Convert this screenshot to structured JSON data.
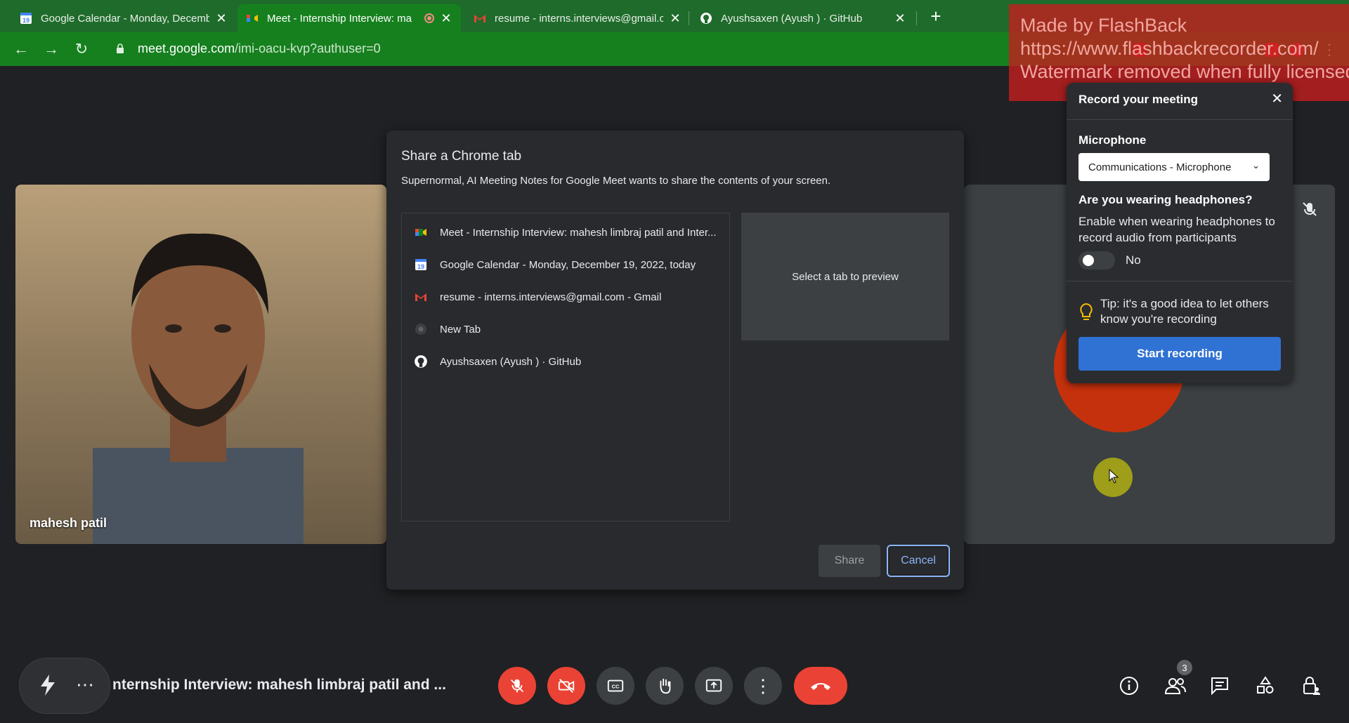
{
  "browser": {
    "tabs": [
      {
        "title": "Google Calendar - Monday, Decemb",
        "icon": "google-calendar-icon",
        "active": false
      },
      {
        "title": "Meet - Internship Interview: ma",
        "icon": "google-meet-icon",
        "active": true,
        "recording": true
      },
      {
        "title": "resume - interns.interviews@gmail.c",
        "icon": "gmail-icon",
        "active": false
      },
      {
        "title": "Ayushsaxen (Ayush ) · GitHub",
        "icon": "github-icon",
        "active": false
      }
    ],
    "url_host": "meet.google.com",
    "url_path": "/imi-oacu-kvp?authuser=0"
  },
  "watermark": {
    "line1": "Made by FlashBack",
    "line2": "https://www.flashbackrecorder.com/",
    "line3": "Watermark removed when fully licensed"
  },
  "participant": {
    "name": "mahesh patil"
  },
  "share_dialog": {
    "title": "Share a Chrome tab",
    "description": "Supernormal, AI Meeting Notes for Google Meet wants to share the contents of your screen.",
    "tabs": [
      {
        "label": "Meet - Internship Interview: mahesh limbraj patil and Inter...",
        "icon": "google-meet-icon"
      },
      {
        "label": "Google Calendar - Monday, December 19, 2022, today",
        "icon": "google-calendar-icon"
      },
      {
        "label": "resume - interns.interviews@gmail.com - Gmail",
        "icon": "gmail-icon"
      },
      {
        "label": "New Tab",
        "icon": "chrome-icon"
      },
      {
        "label": "Ayushsaxen (Ayush ) · GitHub",
        "icon": "github-icon"
      }
    ],
    "preview_text": "Select a tab to preview",
    "share_label": "Share",
    "cancel_label": "Cancel"
  },
  "record_panel": {
    "title": "Record your meeting",
    "mic_label": "Microphone",
    "mic_value": "Communications - Microphone",
    "headphones_label": "Are you wearing headphones?",
    "headphones_desc": "Enable when wearing headphones to record audio from participants",
    "toggle_label": "No",
    "tip": "Tip: it's a good idea to let others know you're recording",
    "start_label": "Start recording"
  },
  "meeting": {
    "title": "nternship Interview: mahesh limbraj patil and ...",
    "people_count": "3"
  },
  "colors": {
    "browser_frame": "#1f6b2b",
    "end_call": "#ea4335",
    "primary_button": "#2f72d4",
    "avatar": "#c5310c"
  }
}
